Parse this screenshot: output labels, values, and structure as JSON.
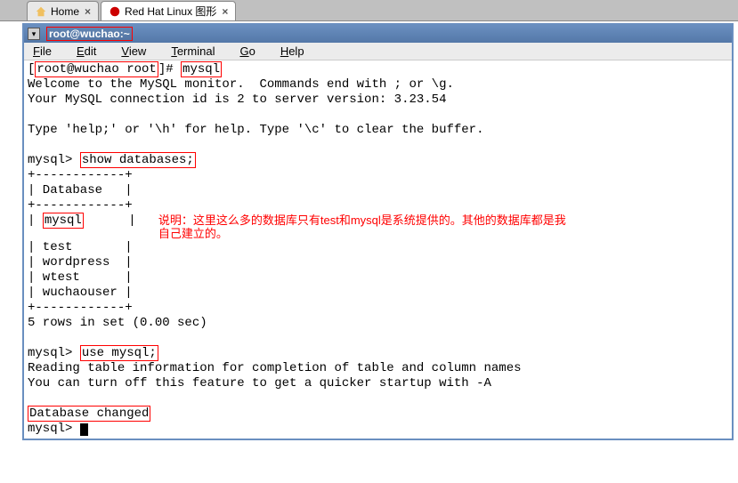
{
  "tabs": {
    "home": {
      "label": "Home"
    },
    "redhat": {
      "label": "Red Hat Linux 图形"
    }
  },
  "window": {
    "title": "root@wuchao:~"
  },
  "menu": {
    "file": "File",
    "edit": "Edit",
    "view": "View",
    "terminal": "Terminal",
    "go": "Go",
    "help": "Help"
  },
  "terminal": {
    "prompt1_userhost": "root@wuchao root",
    "prompt1_suffix": "]# ",
    "cmd1": "mysql",
    "welcome1": "Welcome to the MySQL monitor.  Commands end with ; or \\g.",
    "welcome2": "Your MySQL connection id is 2 to server version: 3.23.54",
    "help_line": "Type 'help;' or '\\h' for help. Type '\\c' to clear the buffer.",
    "mysql_prompt": "mysql> ",
    "cmd_show": "show databases;",
    "tbl_border": "+------------+",
    "tbl_header": "| Database   |",
    "tbl_row_mysql_pre": "| ",
    "tbl_row_mysql": "mysql",
    "tbl_row_mysql_post": "      |",
    "tbl_row_test": "| test       |",
    "tbl_row_wordpress": "| wordpress  |",
    "tbl_row_wtest": "| wtest      |",
    "tbl_row_wuchaouser": "| wuchaouser |",
    "rows_summary": "5 rows in set (0.00 sec)",
    "cmd_use": "use mysql;",
    "reading1": "Reading table information for completion of table and column names",
    "reading2": "You can turn off this feature to get a quicker startup with -A",
    "db_changed": "Database changed",
    "annotation": "说明：这里这么多的数据库只有test和mysql是系统提供的。其他的数据库都是我自己建立的。"
  }
}
